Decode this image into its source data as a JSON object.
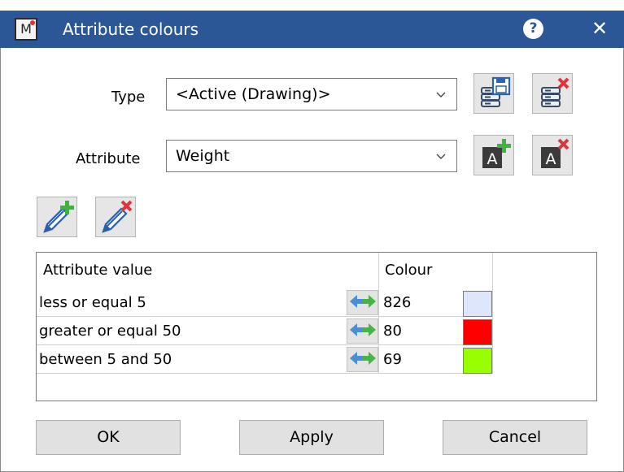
{
  "window": {
    "title": "Attribute colours",
    "app_icon_letter": "M",
    "help_label": "?",
    "close_label": "✕"
  },
  "form": {
    "type_label": "Type",
    "type_value": "<Active (Drawing)>",
    "attribute_label": "Attribute",
    "attribute_value": "Weight"
  },
  "icons": {
    "save_type": "database-save-icon",
    "delete_type": "database-delete-icon",
    "add_attribute": "attribute-add-icon",
    "delete_attribute": "attribute-delete-icon",
    "add_value": "pencil-add-icon",
    "delete_value": "pencil-delete-icon",
    "attribute_glyph": "A"
  },
  "table": {
    "headers": [
      "Attribute value",
      "Colour"
    ],
    "rows": [
      {
        "value": "less or equal 5",
        "colour_code": "826",
        "swatch": "#dde6fb"
      },
      {
        "value": "greater or equal 50",
        "colour_code": "80",
        "swatch": "#ff0000"
      },
      {
        "value": "between 5 and 50",
        "colour_code": "69",
        "swatch": "#99ff00"
      }
    ]
  },
  "buttons": {
    "ok": "OK",
    "apply": "Apply",
    "cancel": "Cancel"
  },
  "colors": {
    "titlebar": "#2b5797",
    "button_face": "#e1e1e1"
  }
}
